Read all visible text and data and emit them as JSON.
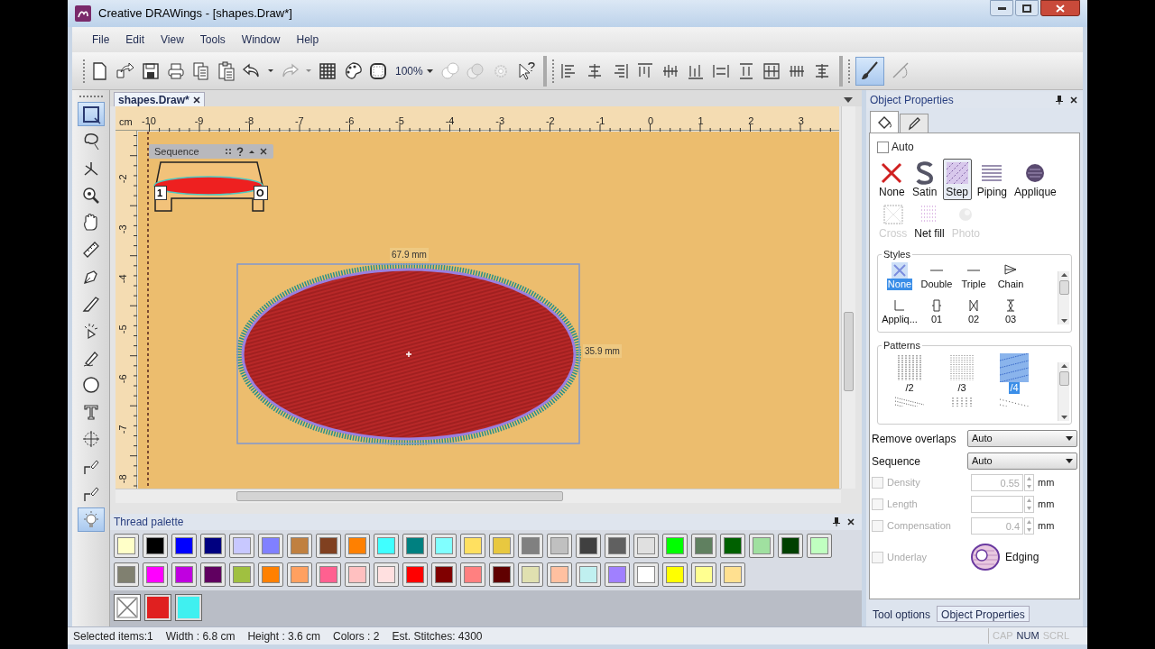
{
  "window": {
    "title": "Creative DRAWings - [shapes.Draw*]"
  },
  "menu": [
    "File",
    "Edit",
    "View",
    "Tools",
    "Window",
    "Help"
  ],
  "toolbar": {
    "zoom": "100%"
  },
  "tools": [
    {
      "selected": true
    },
    {
      "selected": false
    },
    {
      "selected": false
    },
    {
      "selected": false
    },
    {
      "selected": false
    },
    {
      "selected": false
    },
    {
      "selected": false
    },
    {
      "selected": false
    },
    {
      "selected": false
    },
    {
      "selected": false
    },
    {
      "selected": false
    },
    {
      "selected": false
    },
    {
      "selected": false
    },
    {
      "selected": false
    },
    {
      "selected": false
    },
    {
      "selected": true
    }
  ],
  "document_tab": {
    "label": "shapes.Draw*"
  },
  "canvas": {
    "ruler_unit": "cm",
    "x_ruler": [
      "-10",
      "-9",
      "-8",
      "-7",
      "-6",
      "-5",
      "-4",
      "-3",
      "-2",
      "-1",
      "0",
      "1",
      "2",
      "3"
    ],
    "y_ruler": [
      "-2",
      "-3",
      "-4",
      "-5",
      "-6",
      "-7",
      "-8"
    ],
    "sequence_window": {
      "title": "Sequence",
      "start": "1",
      "end": "O"
    },
    "width_label": "67.9 mm",
    "height_label": "35.9 mm"
  },
  "object_properties": {
    "title": "Object Properties",
    "tabs": [
      {
        "selected": true
      },
      {
        "selected": false
      }
    ],
    "auto": {
      "label": "Auto",
      "checked": false
    },
    "stitch_types": [
      {
        "label": "None",
        "selected": false,
        "disabled": false
      },
      {
        "label": "Satin",
        "selected": false,
        "disabled": false
      },
      {
        "label": "Step",
        "selected": true,
        "disabled": false
      },
      {
        "label": "Piping",
        "selected": false,
        "disabled": false
      },
      {
        "label": "Applique",
        "selected": false,
        "disabled": false
      },
      {
        "label": "Cross",
        "selected": false,
        "disabled": true
      },
      {
        "label": "Net fill",
        "selected": false,
        "disabled": false
      },
      {
        "label": "Photo",
        "selected": false,
        "disabled": true
      }
    ],
    "styles": {
      "title": "Styles",
      "items": [
        {
          "label": "None",
          "selected": true
        },
        {
          "label": "Double",
          "selected": false
        },
        {
          "label": "Triple",
          "selected": false
        },
        {
          "label": "Chain",
          "selected": false
        },
        {
          "label": "Appliq...",
          "selected": false
        },
        {
          "label": "01",
          "selected": false
        },
        {
          "label": "02",
          "selected": false
        },
        {
          "label": "03",
          "selected": false
        }
      ]
    },
    "patterns": {
      "title": "Patterns",
      "items": [
        {
          "label": "/2",
          "selected": false
        },
        {
          "label": "/3",
          "selected": false
        },
        {
          "label": "/4",
          "selected": true
        }
      ]
    },
    "dropdowns": [
      {
        "label": "Remove overlaps",
        "value": "Auto"
      },
      {
        "label": "Sequence",
        "value": "Auto"
      }
    ],
    "numeric": [
      {
        "label": "Density",
        "value": "0.55",
        "unit": "mm",
        "checked": false
      },
      {
        "label": "Length",
        "unit": "mm",
        "checked": false
      },
      {
        "label": "Compensation",
        "value": "0.4",
        "unit": "mm",
        "checked": false
      }
    ],
    "underlay": {
      "label": "Underlay",
      "checked": false
    },
    "edging": {
      "label": "Edging"
    }
  },
  "panel_tabs": [
    {
      "label": "Tool options",
      "selected": false
    },
    {
      "label": "Object Properties",
      "selected": true
    }
  ],
  "thread_palette": {
    "title": "Thread palette",
    "swatches": [
      {
        "color": "#ffffc8"
      },
      {
        "color": "#000000"
      },
      {
        "color": "#0000ff"
      },
      {
        "color": "#000080"
      },
      {
        "color": "#c8c8ff"
      },
      {
        "color": "#8080ff"
      },
      {
        "color": "#c08040"
      },
      {
        "color": "#804020"
      },
      {
        "color": "#ff8000"
      },
      {
        "color": "#40ffff"
      },
      {
        "color": "#008080"
      },
      {
        "color": "#80ffff"
      },
      {
        "color": "#ffe060"
      },
      {
        "color": "#e8c840"
      },
      {
        "color": "#808080"
      },
      {
        "color": "#c0c0c0"
      },
      {
        "color": "#404040"
      },
      {
        "color": "#606060"
      },
      {
        "color": "#e0e0e0"
      },
      {
        "color": "#00ff00"
      },
      {
        "color": "#608060"
      },
      {
        "color": "#006000"
      },
      {
        "color": "#a0e0a0"
      },
      {
        "color": "#004000"
      },
      {
        "color": "#c0ffc0"
      },
      {
        "color": "#808070"
      },
      {
        "color": "#ff00ff"
      },
      {
        "color": "#c000e0"
      },
      {
        "color": "#600060"
      },
      {
        "color": "#a0c040"
      },
      {
        "color": "#ff8000"
      },
      {
        "color": "#ffa060"
      },
      {
        "color": "#ff6090"
      },
      {
        "color": "#ffc0c0"
      },
      {
        "color": "#ffe0e0"
      },
      {
        "color": "#ff0000"
      },
      {
        "color": "#800000"
      },
      {
        "color": "#ff8080"
      },
      {
        "color": "#600000"
      },
      {
        "color": "#e0e0b0"
      },
      {
        "color": "#ffc0a0"
      },
      {
        "color": "#c0f0f0"
      },
      {
        "color": "#a080ff"
      },
      {
        "color": "#ffffff"
      },
      {
        "color": "#ffff00"
      },
      {
        "color": "#ffff90"
      },
      {
        "color": "#ffe090"
      }
    ],
    "current_threads": [
      {
        "kind": "none"
      },
      {
        "kind": "color",
        "color": "#e02020"
      },
      {
        "kind": "color",
        "color": "#40f0f0"
      }
    ]
  },
  "status_bar": {
    "items": [
      "Selected items:1",
      "Width : 6.8 cm",
      "Height : 3.6 cm",
      "Colors : 2",
      "Est. Stitches: 4300"
    ],
    "indicators": [
      {
        "label": "CAP",
        "on": false
      },
      {
        "label": "NUM",
        "on": true
      },
      {
        "label": "SCRL",
        "on": false
      }
    ]
  }
}
